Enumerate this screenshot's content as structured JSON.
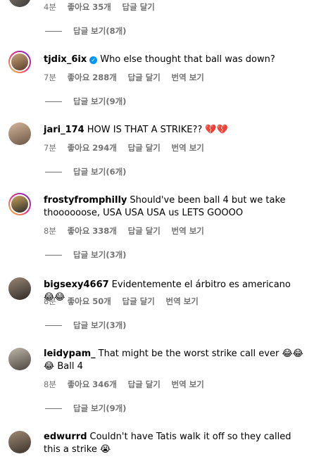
{
  "labels": {
    "like": "좋아요",
    "reply": "답글 달기",
    "translate": "번역 보기"
  },
  "top": {
    "time": "4분",
    "likes": "좋아요 35개",
    "reply": "답글 달기",
    "view_replies": "답글 보기(8개)"
  },
  "comments": [
    {
      "user": "tjdix_6ix",
      "verified": true,
      "text": "Who else thought that ball was down?",
      "time": "7분",
      "likes": "좋아요 288개",
      "reply": "답글 달기",
      "translate": "번역 보기",
      "view_replies": "답글 보기(9개)"
    },
    {
      "user": "jari_174",
      "text": "HOW IS THAT A STRIKE?? 💔💔",
      "time": "7분",
      "likes": "좋아요 294개",
      "reply": "답글 달기",
      "translate": "번역 보기",
      "view_replies": "답글 보기(6개)"
    },
    {
      "user": "frostyfromphilly",
      "text": "Should've been ball 4 but we take thoooooose, USA USA USA us LETS GOOOO",
      "time": "8분",
      "likes": "좋아요 338개",
      "reply": "답글 달기",
      "translate": "번역 보기",
      "view_replies": "답글 보기(3개)"
    },
    {
      "user": "bigsexy4667",
      "text": "Evidentemente el árbitro es americano 😂😂",
      "time": "8분",
      "likes": "좋아요 50개",
      "reply": "답글 달기",
      "translate": "번역 보기",
      "view_replies": "답글 보기(3개)"
    },
    {
      "user": "leidypam_",
      "text": "That might be the worst strike call ever 😂😂😂 Ball 4",
      "time": "8분",
      "likes": "좋아요 346개",
      "reply": "답글 달기",
      "translate": "번역 보기",
      "view_replies": "답글 보기(9개)"
    },
    {
      "user": "edwurrd",
      "text": "Couldn't have Tatis walk it off so they called this a strike 😭"
    }
  ]
}
